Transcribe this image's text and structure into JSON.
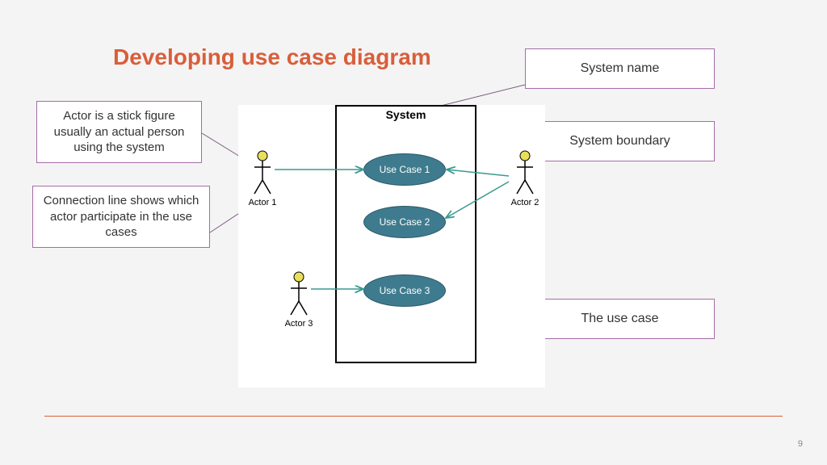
{
  "title": "Developing use case diagram",
  "labels": {
    "actor_desc": "Actor is a stick figure usually an actual person using the system",
    "connection_desc": "Connection line shows which actor participate in the use cases"
  },
  "right": {
    "system_name": "System name",
    "system_boundary": "System boundary",
    "use_case": "The use case"
  },
  "diagram": {
    "system_label": "System",
    "use_cases": [
      "Use Case 1",
      "Use Case 2",
      "Use Case 3"
    ],
    "actors": [
      "Actor 1",
      "Actor 2",
      "Actor 3"
    ]
  },
  "page_number": "9"
}
